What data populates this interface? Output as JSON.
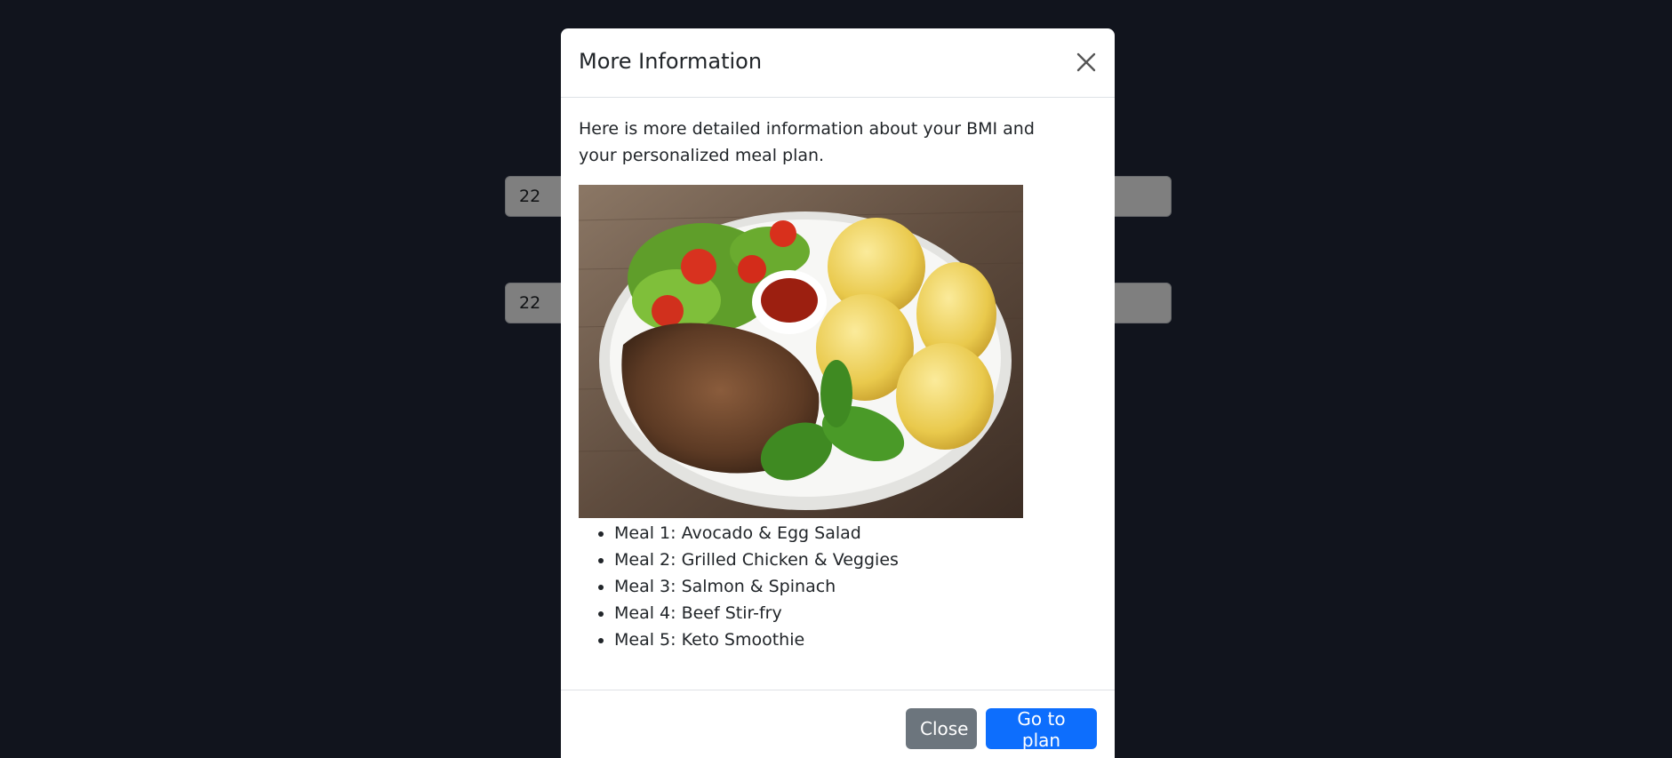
{
  "background_form": {
    "input_1_value": "22",
    "input_2_value": "22"
  },
  "modal": {
    "title": "More Information",
    "description": "Here is more detailed information about your BMI and your personalized meal plan.",
    "image_subject": "plate with grilled steak, boiled potatoes with dill, salad, tomatoes and ketchup",
    "meals": [
      "Meal 1: Avocado & Egg Salad",
      "Meal 2: Grilled Chicken & Veggies",
      "Meal 3: Salmon & Spinach",
      "Meal 4: Beef Stir-fry",
      "Meal 5: Keto Smoothie"
    ],
    "close_button_label": "Close",
    "plan_button_label": "Go to plan"
  },
  "colors": {
    "page_background": "#23283a",
    "primary": "#0d6efd",
    "secondary": "#6c757d"
  }
}
